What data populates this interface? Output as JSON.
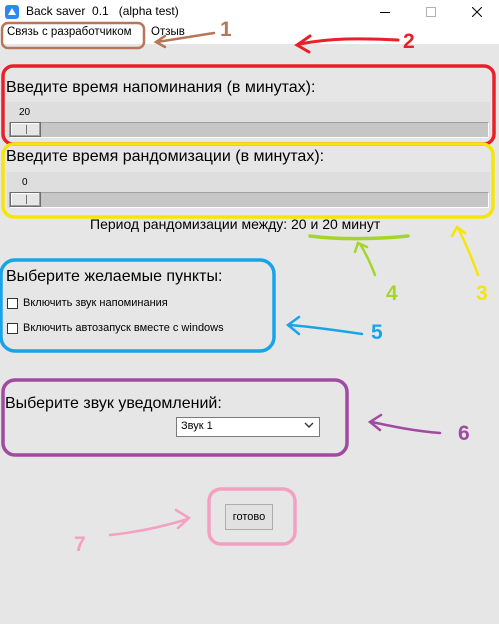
{
  "window": {
    "title": "Back saver  0.1   (alpha test)",
    "icon": "app-icon",
    "controls": [
      "minimize-icon",
      "maximize-icon",
      "close-icon"
    ]
  },
  "menu": {
    "items": [
      {
        "label": "Связь с разработчиком"
      },
      {
        "label": "Отзыв"
      }
    ]
  },
  "reminder": {
    "heading": "Введите время напоминания (в минутах):",
    "value": "20"
  },
  "randomization": {
    "heading": "Введите время рандомизации (в минутах):",
    "value": "0"
  },
  "period": {
    "text": "Период рандомизации между: 20 и 20 минут"
  },
  "options": {
    "heading": "Выберите желаемые пункты:",
    "items": [
      {
        "label": "Включить звук напоминания",
        "checked": false
      },
      {
        "label": "Включить автозапуск вместе с windows",
        "checked": false
      }
    ]
  },
  "sound": {
    "heading": "Выберите звук уведомлений:",
    "selected": "Звук 1"
  },
  "done": {
    "label": "готово"
  },
  "annotations": {
    "labels": [
      "1",
      "2",
      "3",
      "4",
      "5",
      "6",
      "7"
    ],
    "colors": {
      "brown": "#b5775a",
      "red": "#e8202a",
      "yellow": "#f5e50a",
      "green": "#a6d52a",
      "blue": "#1aa4e8",
      "purple": "#a04aa0",
      "pink": "#f4a0c0"
    }
  }
}
